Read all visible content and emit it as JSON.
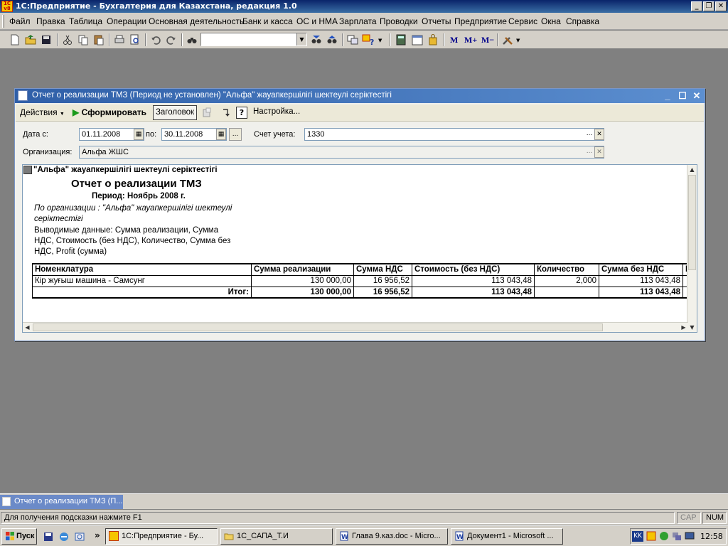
{
  "app": {
    "title": "1С:Предприятие - Бухгалтерия для Казахстана, редакция 1.0",
    "logo_text": "1С v8"
  },
  "menu": [
    "Файл",
    "Правка",
    "Таблица",
    "Операции",
    "Основная деятельность",
    "Банк и касса",
    "ОС и НМА",
    "Зарплата",
    "Проводки",
    "Отчеты",
    "Предприятие",
    "Сервис",
    "Окна",
    "Справка"
  ],
  "toolbar": {
    "m_labels": [
      "M",
      "M+",
      "M−"
    ]
  },
  "report_window": {
    "title": "Отчет о реализации ТМЗ (Период не установлен) \"Альфа\" жауапкершілігі шектеулі серіктестігі",
    "actions_label": "Действия",
    "form_label": "Сформировать",
    "header_label": "Заголовок",
    "settings_label": "Настройка...",
    "help_label": "?"
  },
  "form": {
    "date_from_label": "Дата с:",
    "date_from": "01.11.2008",
    "date_to_label": "по:",
    "date_to": "30.11.2008",
    "ellipsis": "...",
    "account_label": "Счет учета:",
    "account": "1330",
    "org_label": "Организация:",
    "org": "Альфа ЖШС"
  },
  "report": {
    "org_heading": "\"Альфа\" жауапкершілігі шектеулі серіктестігі",
    "title": "Отчет о реализации ТМЗ",
    "period": "Период: Ноябрь 2008 г.",
    "org_filter_line1": "По организации : \"Альфа\" жауапкершілігі шектеулі",
    "org_filter_line2": "серіктестігі",
    "output_line1": "Выводимые данные:  Сумма реализации, Сумма",
    "output_line2": "НДС, Стоимость (без НДС), Количество, Сумма без",
    "output_line3": "НДС, Profit (сумма)",
    "columns": [
      "Номенклатура",
      "Сумма реализации",
      "Сумма НДС",
      "Стоимость (без НДС)",
      "Количество",
      "Сумма без НДС",
      "P"
    ],
    "rows": [
      {
        "name": "Кір жуғыш машина - Самсунг",
        "sales": "130 000,00",
        "vat": "16 956,52",
        "cost": "113 043,48",
        "qty": "2,000",
        "net": "113 043,48"
      }
    ],
    "total": {
      "label": "Итог:",
      "sales": "130 000,00",
      "vat": "16 956,52",
      "cost": "113 043,48",
      "qty": "",
      "net": "113 043,48"
    }
  },
  "mdi_tab": "Отчет о реализации ТМЗ (П...",
  "status": {
    "hint": "Для получения подсказки нажмите F1",
    "cap": "CAP",
    "num": "NUM"
  },
  "taskbar": {
    "start": "Пуск",
    "more": "»",
    "tasks": [
      "1С:Предприятие - Бу...",
      "1С_САПА_Т.И",
      "Глава 9.каз.doc - Micro...",
      "Документ1 - Microsoft ..."
    ],
    "lang": "KK",
    "clock": "12:58"
  },
  "colors": {
    "title_bar": "#0a246a",
    "child_title": "#2f5fa8",
    "workspace": "#808080",
    "run_icon": "#1a9a1a"
  }
}
